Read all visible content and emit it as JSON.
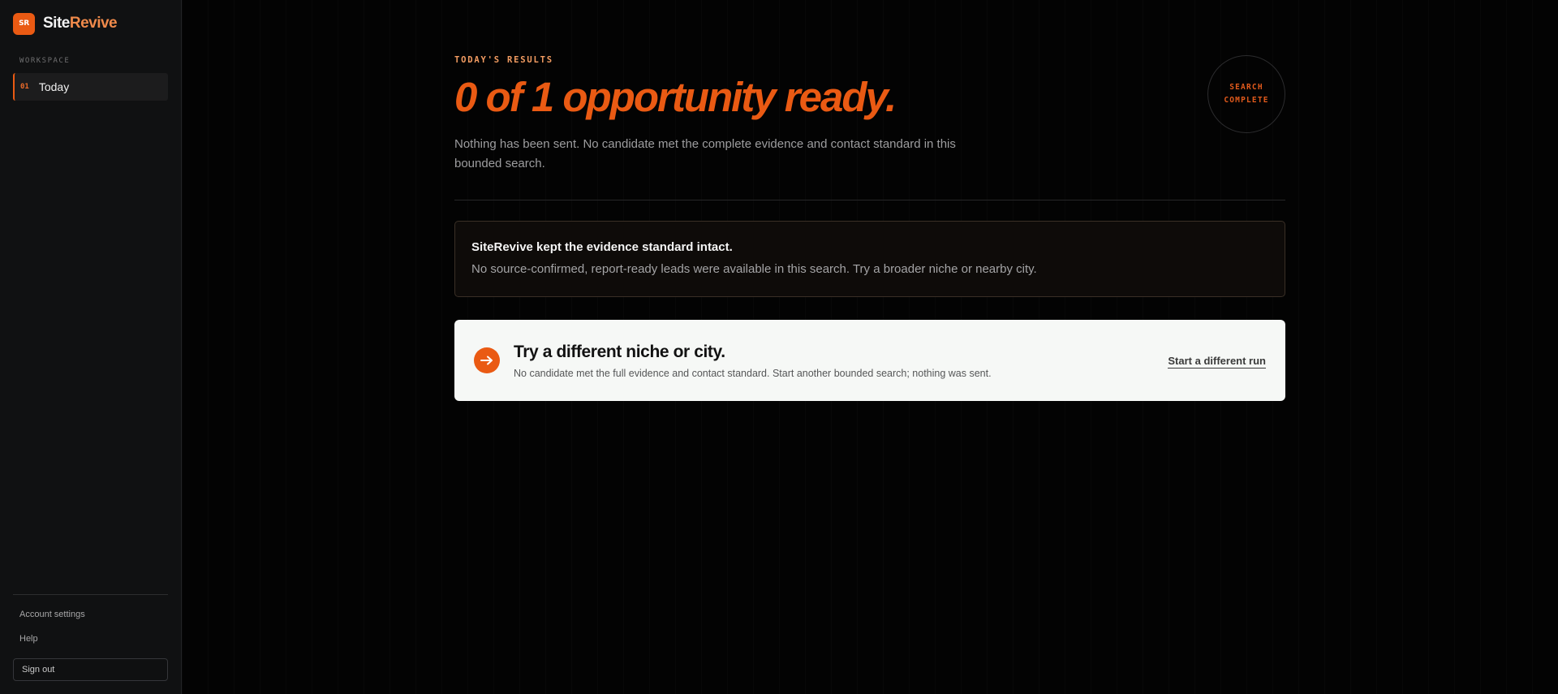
{
  "app": {
    "logo_text": "SR",
    "brand_part1": "Site",
    "brand_part2": "Revive"
  },
  "sidebar": {
    "section_label": "WORKSPACE",
    "items": [
      {
        "number": "01",
        "label": "Today",
        "active": true
      }
    ],
    "footer_links": [
      "Account settings",
      "Help"
    ],
    "signout_label": "Sign out"
  },
  "main": {
    "eyebrow": "TODAY'S RESULTS",
    "headline": "0 of 1 opportunity ready.",
    "lead": "Nothing has been sent. No candidate met the complete evidence and contact standard in this bounded search.",
    "status_badge_line1": "SEARCH",
    "status_badge_line2": "COMPLETE",
    "notice": {
      "title": "SiteRevive kept the evidence standard intact.",
      "body": "No source-confirmed, report-ready leads were available in this search. Try a broader niche or nearby city."
    },
    "cta": {
      "icon": "arrow-right-icon",
      "title": "Try a different niche or city.",
      "body": "No candidate met the full evidence and contact standard. Start another bounded search; nothing was sent.",
      "link_label": "Start a different run"
    }
  },
  "colors": {
    "accent": "#ea5a13",
    "background": "#030303",
    "sidebar": "#101112",
    "cta_background": "#f6f8f6"
  }
}
